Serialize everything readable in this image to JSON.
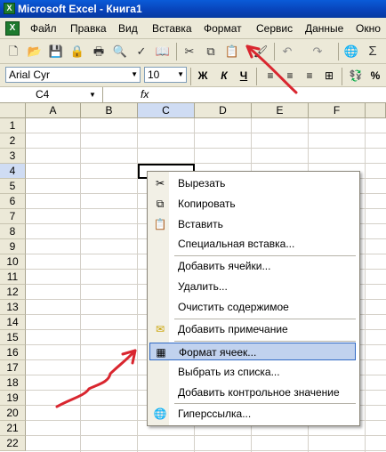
{
  "window": {
    "title": "Microsoft Excel - Книга1",
    "app_icon": "X"
  },
  "menu": {
    "doc_icon": "X",
    "items": [
      "Файл",
      "Правка",
      "Вид",
      "Вставка",
      "Формат",
      "Сервис",
      "Данные",
      "Окно"
    ]
  },
  "toolbar": {
    "font_name": "Arial Cyr",
    "font_size": "10",
    "bold": "Ж",
    "italic": "К",
    "underline": "Ч",
    "percent": "%",
    "sum": "Σ"
  },
  "formula_bar": {
    "cell_ref": "C4",
    "fx": "fx"
  },
  "sheet": {
    "columns": [
      "A",
      "B",
      "C",
      "D",
      "E",
      "F"
    ],
    "rows": [
      "1",
      "2",
      "3",
      "4",
      "5",
      "6",
      "7",
      "8",
      "9",
      "10",
      "11",
      "12",
      "13",
      "14",
      "15",
      "16",
      "17",
      "18",
      "19",
      "20",
      "21",
      "22"
    ],
    "selected_column": "C",
    "selected_row": "4"
  },
  "context_menu": {
    "items": [
      {
        "label": "Вырезать",
        "icon": "scissors-icon"
      },
      {
        "label": "Копировать",
        "icon": "copy-icon"
      },
      {
        "label": "Вставить",
        "icon": "paste-icon"
      },
      {
        "label": "Специальная вставка...",
        "icon": ""
      },
      {
        "label": "Добавить ячейки...",
        "icon": ""
      },
      {
        "label": "Удалить...",
        "icon": ""
      },
      {
        "label": "Очистить содержимое",
        "icon": ""
      },
      {
        "label": "Добавить примечание",
        "icon": "comment-icon"
      },
      {
        "label": "Формат ячеек...",
        "icon": "format-cells-icon",
        "highlighted": true
      },
      {
        "label": "Выбрать из списка...",
        "icon": ""
      },
      {
        "label": "Добавить контрольное значение",
        "icon": ""
      },
      {
        "label": "Гиперссылка...",
        "icon": "hyperlink-icon"
      }
    ]
  },
  "colors": {
    "title_bar": "#0842b8",
    "highlight": "#c1d2ee",
    "annotation_arrow": "#d9262f"
  }
}
